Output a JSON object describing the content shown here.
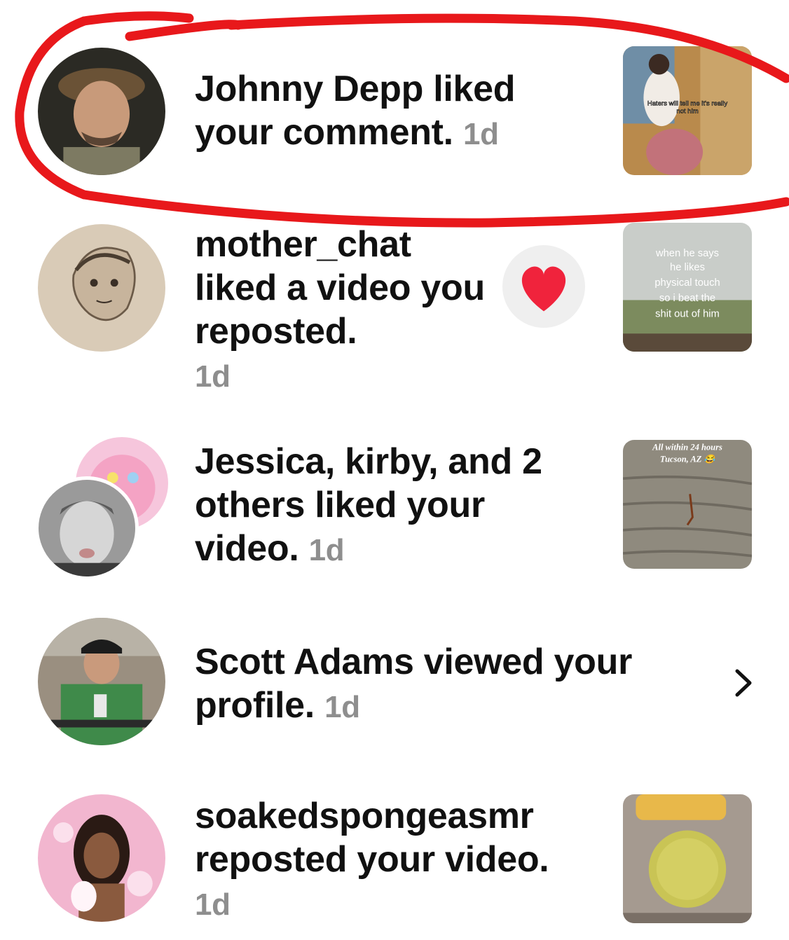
{
  "notifications": [
    {
      "text": "Johnny Depp liked your comment.",
      "time": "1d",
      "thumbnail_caption": "Haters will tell me it's really not him"
    },
    {
      "text": "mother_chat liked a video you reposted.",
      "time": "1d",
      "thumbnail_caption": "when he says he likes physical touch so i beat the shit out of him",
      "action_icon": "heart-icon"
    },
    {
      "text": "Jessica, kirby, and 2 others liked your video.",
      "time": "1d",
      "thumbnail_caption": "All within 24 hours Tucson, AZ 😂"
    },
    {
      "text": "Scott Adams viewed your profile.",
      "time": "1d",
      "action_icon": "chevron-right-icon"
    },
    {
      "text": "soakedspongeasmr reposted your video.",
      "time": "1d"
    }
  ],
  "colors": {
    "annotation_circle": "#e8181b",
    "timestamp": "#8e8e8e",
    "heart": "#f0233c",
    "heart_bg": "#efefef"
  }
}
